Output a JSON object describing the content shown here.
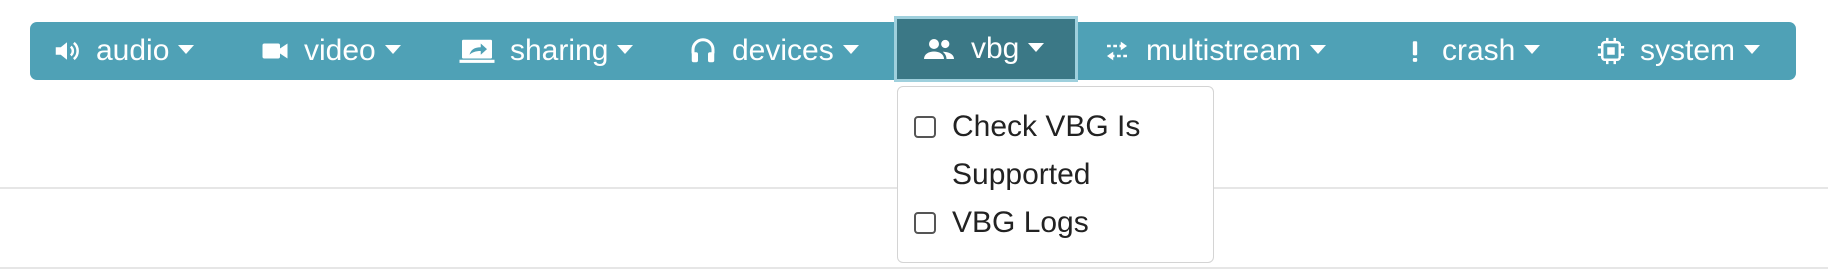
{
  "navbar": {
    "background_color": "#4fa1b6",
    "active_background_color": "#3b7886",
    "items": [
      {
        "label": "audio",
        "icon": "speaker-icon"
      },
      {
        "label": "video",
        "icon": "video-camera-icon"
      },
      {
        "label": "sharing",
        "icon": "screen-share-icon"
      },
      {
        "label": "devices",
        "icon": "headphones-icon"
      },
      {
        "label": "vbg",
        "icon": "people-icon",
        "active": true
      },
      {
        "label": "multistream",
        "icon": "swap-arrows-icon"
      },
      {
        "label": "crash",
        "icon": "exclamation-icon"
      },
      {
        "label": "system",
        "icon": "cpu-chip-icon"
      }
    ]
  },
  "vbg_dropdown": {
    "items": [
      {
        "label": "Check VBG Is Supported",
        "checked": false
      },
      {
        "label": "VBG Logs",
        "checked": false
      }
    ]
  }
}
